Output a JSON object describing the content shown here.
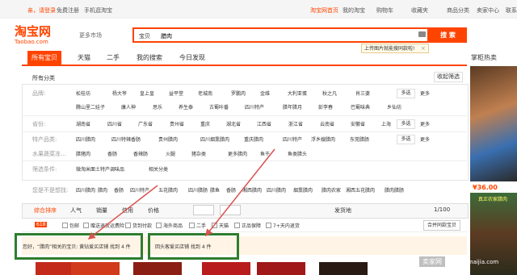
{
  "topbar": {
    "greeting": "亲，请登录",
    "register": "免费注册",
    "mobile": "手机逛淘宝",
    "home": "淘宝网首页",
    "my_taobao": "我的淘宝",
    "cart": "购物车",
    "favorites": "收藏夹",
    "categories": "商品分类",
    "seller_center": "卖家中心",
    "contact": "联系"
  },
  "logo": {
    "cn": "淘宝网",
    "en": "Taobao.com"
  },
  "market_label": "更多市场",
  "search": {
    "scope": "宝贝",
    "query": "腊肉",
    "button": "搜 索",
    "tip": "上传图片就能搜同款啦!"
  },
  "tabs": [
    "所有宝贝",
    "天猫",
    "二手",
    "我的搜索",
    "今日发现"
  ],
  "breadcrumb": "所有分类",
  "collapse": "收起筛选",
  "filters": {
    "brand_label": "品牌:",
    "brands_row1": [
      "松桂坊",
      "杨大爷",
      "皇上皇",
      "益平堂",
      "老城南",
      "罗鹏肉",
      "金维",
      "大利亚蛋",
      "秋之凡",
      "肖三婆"
    ],
    "brands_row2": [
      "腾山里二娃子",
      "康人神",
      "思乐",
      "养生泰",
      "古蜀咔番",
      "四川特产",
      "腊年腊月",
      "彭李春",
      "巴蜀味典",
      "乡仙坊"
    ],
    "origin_label": "省份:",
    "origins": [
      "湖南省",
      "四川省",
      "广东省",
      "贵州省",
      "重庆",
      "湖北省",
      "江西省",
      "浙江省",
      "云南省",
      "安徽省",
      "上海"
    ],
    "special_label": "特产品类:",
    "special_row1": [
      "四川腊肉",
      "四川特辣香肠",
      "贵州腊肉",
      "四川烟熏腊肉",
      "重庆腊肉",
      "四川特产",
      "浮乡嫂腊肉",
      "东莞腊肠"
    ],
    "special_row2": [
      "腊猪肉",
      "香肠",
      "香辣肠",
      "火腿",
      "猪杂类",
      "更多腊肉",
      "鱼干",
      "鱼类腊头"
    ],
    "food_label": "水果蔬菜冻...",
    "conditions_label": "筛选条件:",
    "conditions": [
      "微淘米面土特产调味品",
      "相关分类"
    ],
    "multi": "多选",
    "more": "更多"
  },
  "related_label": "您是不是想找:",
  "related": [
    "四川腊肉",
    "腊肉",
    "香肠",
    "四川特产",
    "五花腊肉",
    "四川腊肠",
    "腊鱼",
    "香肠",
    "湘西腊肉",
    "四川腊肉",
    "烟熏腊肉",
    "腊肉农家",
    "湘西五花腊肉",
    "腊肉腊肠"
  ],
  "sort": [
    "综合排序",
    "人气",
    "销量",
    "信用",
    "价格"
  ],
  "delivery": "发货地",
  "pager": "1/100",
  "options": [
    "包邮",
    "赠送退货运费险",
    "货到付款",
    "海外商品",
    "二手",
    "天猫",
    "正品保障",
    "7+天内退货"
  ],
  "badge": "618",
  "compare": "合并同款宝贝",
  "notice1": "您好，“腊肉”相关的宝贝: 黄钻爱买店铺 找到 4 件",
  "notice2": "回头客爱买店铺 找到 4 件",
  "right": {
    "header": "掌柜热卖",
    "price": "¥36.00",
    "img2_label": "真正农家腊肉"
  },
  "watermark": {
    "text": "卖家网",
    "url": "www.maijia.com"
  },
  "colors": {
    "accent": "#ff4400",
    "highlight_border": "#2e7d2e",
    "arrow": "#d9534f"
  }
}
